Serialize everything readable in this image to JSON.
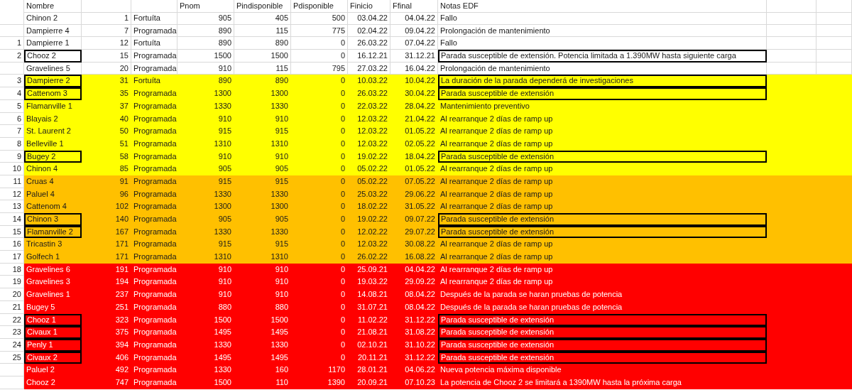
{
  "header": {
    "nombre": "Nombre",
    "pnom": "Pnom",
    "pindisponible": "Pindisponible",
    "pdisponible": "Pdisponible",
    "finicio": "Finicio",
    "ffinal": "Ffinal",
    "notas": "Notas EDF"
  },
  "rows": [
    {
      "nombre": "Chinon 2",
      "column_2": "1",
      "column_3": "Fortuíta",
      "pnom": "905",
      "pindisponible": "405",
      "pdisponible": "500",
      "finicio": "03.04.22",
      "ffinal": "04.04.22",
      "notas": "Fallo",
      "color": "#ffffff",
      "flagged": false
    },
    {
      "nombre": "Dampierre 4",
      "column_2": "7",
      "column_3": "Programada",
      "pnom": "890",
      "pindisponible": "115",
      "pdisponible": "775",
      "finicio": "02.04.22",
      "ffinal": "09.04.22",
      "notas": "Prolongación de mantenimiento",
      "color": "#ffffff",
      "flagged": false
    },
    {
      "index": "1",
      "nombre": "Dampierre 1",
      "column_2": "12",
      "column_3": "Fortuíta",
      "pnom": "890",
      "pindisponible": "890",
      "pdisponible": "0",
      "finicio": "26.03.22",
      "ffinal": "07.04.22",
      "notas": "Fallo",
      "color": "#ffffff",
      "flagged": false
    },
    {
      "index": "2",
      "nombre": "Chooz 2",
      "column_2": "15",
      "column_3": "Programada",
      "pnom": "1500",
      "pindisponible": "1500",
      "pdisponible": "0",
      "finicio": "16.12.21",
      "ffinal": "31.12.21",
      "notas": "Parada susceptible de extensión. Potencia limitada a 1.390MW hasta siguiente carga",
      "color": "#ffffff",
      "flagged": true
    },
    {
      "nombre": "Gravelines 5",
      "column_2": "20",
      "column_3": "Programada",
      "pnom": "910",
      "pindisponible": "115",
      "pdisponible": "795",
      "finicio": "27.03.22",
      "ffinal": "16.04.22",
      "notas": "Prolongación de mantenimiento",
      "color": "#ffffff",
      "flagged": false
    },
    {
      "index": "3",
      "nombre": "Dampierre 2",
      "column_2": "31",
      "column_3": "Fortuíta",
      "pnom": "890",
      "pindisponible": "890",
      "pdisponible": "0",
      "finicio": "10.03.22",
      "ffinal": "10.04.22",
      "notas": "La duración de la parada dependerá de investigaciones",
      "color": "#ffff00",
      "flagged": true
    },
    {
      "index": "4",
      "nombre": "Cattenom 3",
      "column_2": "35",
      "column_3": "Programada",
      "pnom": "1300",
      "pindisponible": "1300",
      "pdisponible": "0",
      "finicio": "26.03.22",
      "ffinal": "30.04.22",
      "notas": "Parada susceptible de extensión",
      "color": "#ffff00",
      "flagged": true
    },
    {
      "index": "5",
      "nombre": "Flamanville 1",
      "column_2": "37",
      "column_3": "Programada",
      "pnom": "1330",
      "pindisponible": "1330",
      "pdisponible": "0",
      "finicio": "22.03.22",
      "ffinal": "28.04.22",
      "notas": "Mantenimiento preventivo",
      "color": "#ffff00",
      "flagged": false
    },
    {
      "index": "6",
      "nombre": "Blayais 2",
      "column_2": "40",
      "column_3": "Programada",
      "pnom": "910",
      "pindisponible": "910",
      "pdisponible": "0",
      "finicio": "12.03.22",
      "ffinal": "21.04.22",
      "notas": "Al rearranque 2 días de ramp up",
      "color": "#ffff00",
      "flagged": false
    },
    {
      "index": "7",
      "nombre": "St. Laurent 2",
      "column_2": "50",
      "column_3": "Programada",
      "pnom": "915",
      "pindisponible": "915",
      "pdisponible": "0",
      "finicio": "12.03.22",
      "ffinal": "01.05.22",
      "notas": "Al rearranque 2 días de ramp up",
      "color": "#ffff00",
      "flagged": false
    },
    {
      "index": "8",
      "nombre": "Belleville 1",
      "column_2": "51",
      "column_3": "Programada",
      "pnom": "1310",
      "pindisponible": "1310",
      "pdisponible": "0",
      "finicio": "12.03.22",
      "ffinal": "02.05.22",
      "notas": "Al rearranque 2 días de ramp up",
      "color": "#ffff00",
      "flagged": false
    },
    {
      "index": "9",
      "nombre": "Bugey 2",
      "column_2": "58",
      "column_3": "Programada",
      "pnom": "910",
      "pindisponible": "910",
      "pdisponible": "0",
      "finicio": "19.02.22",
      "ffinal": "18.04.22",
      "notas": "Parada susceptible de extensión",
      "color": "#ffff00",
      "flagged": true
    },
    {
      "index": "10",
      "nombre": "Chinon 4",
      "column_2": "85",
      "column_3": "Programada",
      "pnom": "905",
      "pindisponible": "905",
      "pdisponible": "0",
      "finicio": "05.02.22",
      "ffinal": "01.05.22",
      "notas": "Al rearranque 2 días de ramp up",
      "color": "#ffff00",
      "flagged": false
    },
    {
      "index": "11",
      "nombre": "Cruas 4",
      "column_2": "91",
      "column_3": "Programada",
      "pnom": "915",
      "pindisponible": "915",
      "pdisponible": "0",
      "finicio": "05.02.22",
      "ffinal": "07.05.22",
      "notas": "Al rearranque 2 días de ramp up",
      "color": "#ffc000",
      "flagged": false
    },
    {
      "index": "12",
      "nombre": "Paluel 4",
      "column_2": "96",
      "column_3": "Programada",
      "pnom": "1330",
      "pindisponible": "1330",
      "pdisponible": "0",
      "finicio": "25.03.22",
      "ffinal": "29.06.22",
      "notas": "Al rearranque 2 días de ramp up",
      "color": "#ffc000",
      "flagged": false
    },
    {
      "index": "13",
      "nombre": "Cattenom 4",
      "column_2": "102",
      "column_3": "Programada",
      "pnom": "1300",
      "pindisponible": "1300",
      "pdisponible": "0",
      "finicio": "18.02.22",
      "ffinal": "31.05.22",
      "notas": "Al rearranque 2 días de ramp up",
      "color": "#ffc000",
      "flagged": false
    },
    {
      "index": "14",
      "nombre": "Chinon 3",
      "column_2": "140",
      "column_3": "Programada",
      "pnom": "905",
      "pindisponible": "905",
      "pdisponible": "0",
      "finicio": "19.02.22",
      "ffinal": "09.07.22",
      "notas": "Parada susceptible de extensión",
      "color": "#ffc000",
      "flagged": true
    },
    {
      "index": "15",
      "nombre": "Flamanville 2",
      "column_2": "167",
      "column_3": "Programada",
      "pnom": "1330",
      "pindisponible": "1330",
      "pdisponible": "0",
      "finicio": "12.02.22",
      "ffinal": "29.07.22",
      "notas": "Parada susceptible de extensión",
      "color": "#ffc000",
      "flagged": true
    },
    {
      "index": "16",
      "nombre": "Tricastin 3",
      "column_2": "171",
      "column_3": "Programada",
      "pnom": "915",
      "pindisponible": "915",
      "pdisponible": "0",
      "finicio": "12.03.22",
      "ffinal": "30.08.22",
      "notas": "Al rearranque 2 días de ramp up",
      "color": "#ffc000",
      "flagged": false
    },
    {
      "index": "17",
      "nombre": "Golfech 1",
      "column_2": "171",
      "column_3": "Programada",
      "pnom": "1310",
      "pindisponible": "1310",
      "pdisponible": "0",
      "finicio": "26.02.22",
      "ffinal": "16.08.22",
      "notas": "Al rearranque 2 días de ramp up",
      "color": "#ffc000",
      "flagged": false
    },
    {
      "index": "18",
      "nombre": "Gravelines 6",
      "column_2": "191",
      "column_3": "Programada",
      "pnom": "910",
      "pindisponible": "910",
      "pdisponible": "0",
      "finicio": "25.09.21",
      "ffinal": "04.04.22",
      "notas": "Al rearranque 2 días de ramp up",
      "color": "#ff0000",
      "flagged": false
    },
    {
      "index": "19",
      "nombre": "Gravelines 3",
      "column_2": "194",
      "column_3": "Programada",
      "pnom": "910",
      "pindisponible": "910",
      "pdisponible": "0",
      "finicio": "19.03.22",
      "ffinal": "29.09.22",
      "notas": "Al rearranque 2 días de ramp up",
      "color": "#ff0000",
      "flagged": false
    },
    {
      "index": "20",
      "nombre": "Gravelines 1",
      "column_2": "237",
      "column_3": "Programada",
      "pnom": "910",
      "pindisponible": "910",
      "pdisponible": "0",
      "finicio": "14.08.21",
      "ffinal": "08.04.22",
      "notas": "Después de la parada se haran pruebas de potencia",
      "color": "#ff0000",
      "flagged": false
    },
    {
      "index": "21",
      "nombre": "Bugey 5",
      "column_2": "251",
      "column_3": "Programada",
      "pnom": "880",
      "pindisponible": "880",
      "pdisponible": "0",
      "finicio": "31.07.21",
      "ffinal": "08.04.22",
      "notas": "Después de la parada se haran pruebas de potencia",
      "color": "#ff0000",
      "flagged": false
    },
    {
      "index": "22",
      "nombre": "Chooz 1",
      "column_2": "323",
      "column_3": "Programada",
      "pnom": "1500",
      "pindisponible": "1500",
      "pdisponible": "0",
      "finicio": "11.02.22",
      "ffinal": "31.12.22",
      "notas": "Parada susceptible de extensión",
      "color": "#ff0000",
      "flagged": true
    },
    {
      "index": "23",
      "nombre": "Civaux 1",
      "column_2": "375",
      "column_3": "Programada",
      "pnom": "1495",
      "pindisponible": "1495",
      "pdisponible": "0",
      "finicio": "21.08.21",
      "ffinal": "31.08.22",
      "notas": "Parada susceptible de extensión",
      "color": "#ff0000",
      "flagged": true
    },
    {
      "index": "24",
      "nombre": "Penly 1",
      "column_2": "394",
      "column_3": "Programada",
      "pnom": "1330",
      "pindisponible": "1330",
      "pdisponible": "0",
      "finicio": "02.10.21",
      "ffinal": "31.10.22",
      "notas": "Parada susceptible de extensión",
      "color": "#ff0000",
      "flagged": true
    },
    {
      "index": "25",
      "nombre": "Civaux 2",
      "column_2": "406",
      "column_3": "Programada",
      "pnom": "1495",
      "pindisponible": "1495",
      "pdisponible": "0",
      "finicio": "20.11.21",
      "ffinal": "31.12.22",
      "notas": "Parada susceptible de extensión",
      "color": "#ff0000",
      "flagged": true
    },
    {
      "nombre": "Paluel 2",
      "column_2": "492",
      "column_3": "Programada",
      "pnom": "1330",
      "pindisponible": "160",
      "pdisponible": "1170",
      "finicio": "28.01.21",
      "ffinal": "04.06.22",
      "notas": "Nueva potencia máxima disponible",
      "color": "#ff0000",
      "flagged": false
    },
    {
      "nombre": "Chooz 2",
      "column_2": "747",
      "column_3": "Programada",
      "pnom": "1500",
      "pindisponible": "110",
      "pdisponible": "1390",
      "finicio": "20.09.21",
      "ffinal": "07.10.23",
      "notas": "La potencia de Chooz 2 se limitará a 1390MW hasta la próxima carga",
      "color": "#ff0000",
      "flagged": false
    }
  ]
}
